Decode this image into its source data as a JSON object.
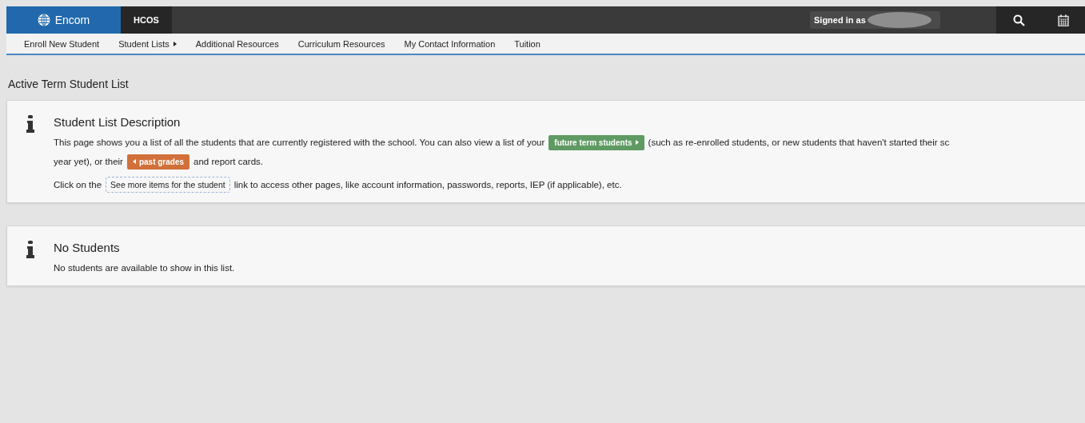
{
  "topbar": {
    "brand": "Encom",
    "app_tab": "HCOS",
    "signed_in": "Signed in as"
  },
  "nav": [
    {
      "label": "Enroll New Student",
      "submenu": false
    },
    {
      "label": "Student Lists",
      "submenu": true
    },
    {
      "label": "Additional Resources",
      "submenu": false
    },
    {
      "label": "Curriculum Resources",
      "submenu": false
    },
    {
      "label": "My Contact Information",
      "submenu": false
    },
    {
      "label": "Tuition",
      "submenu": false
    }
  ],
  "page_title": "Active Term Student List",
  "cards": [
    {
      "title": "Student List Description",
      "paragraphs": [
        [
          [
            {
              "kind": "text",
              "text": "This page shows you a list of all the students that are currently registered with the school. You can also view a list of your"
            },
            {
              "kind": "forward_button",
              "text": "future term students"
            },
            {
              "kind": "text",
              "text": "(such as re-enrolled students, or new students that haven't started their sc"
            }
          ],
          [
            {
              "kind": "text",
              "text": "year yet), or their"
            },
            {
              "kind": "back_button",
              "text": "past grades"
            },
            {
              "kind": "text",
              "text": "and report cards."
            }
          ]
        ],
        [
          [
            {
              "kind": "text",
              "text": "Click on the"
            },
            {
              "kind": "dashed_link",
              "text": "See more items for the student"
            },
            {
              "kind": "text",
              "text": "link to access other pages, like account information, passwords, reports, IEP (if applicable), etc."
            }
          ]
        ]
      ]
    },
    {
      "title": "No Students",
      "paragraphs": [
        [
          [
            {
              "kind": "text",
              "text": "No students are available to show in this list."
            }
          ]
        ]
      ]
    }
  ]
}
